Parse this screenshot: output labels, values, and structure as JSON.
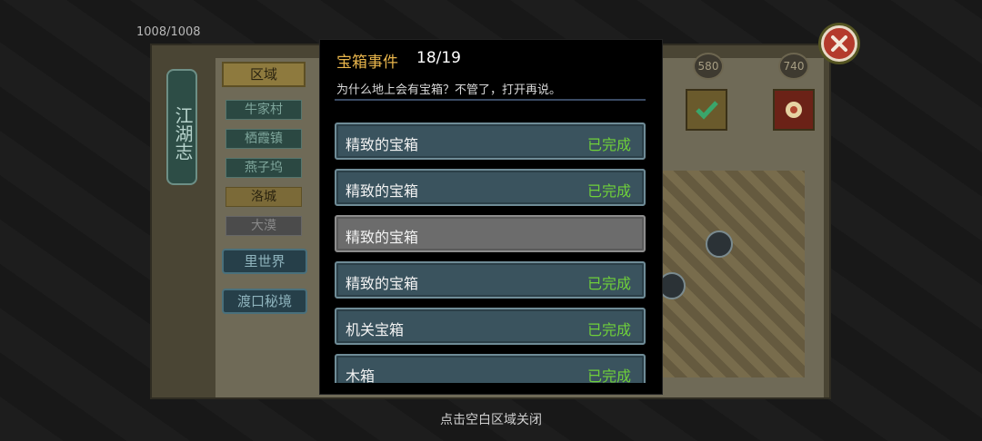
{
  "background": {
    "hp": "1008/1008",
    "banner_title": "江湖志",
    "region_header": "区域",
    "regions": [
      {
        "label": "牛家村",
        "style": "normal"
      },
      {
        "label": "栖霞镇",
        "style": "normal"
      },
      {
        "label": "燕子坞",
        "style": "normal"
      },
      {
        "label": "洛城",
        "style": "gold"
      },
      {
        "label": "大漠",
        "style": "dim"
      }
    ],
    "inner_world": "里世界",
    "ferry_realm": "渡口秘境",
    "top_numbers": [
      "580",
      "740"
    ]
  },
  "modal": {
    "title": "宝箱事件",
    "count": "18/19",
    "description": "为什么地上会有宝箱？不管了，打开再说。",
    "events": [
      {
        "name": "精致的宝箱",
        "status": "已完成",
        "completed": true
      },
      {
        "name": "精致的宝箱",
        "status": "已完成",
        "completed": true
      },
      {
        "name": "精致的宝箱",
        "status": "",
        "completed": false
      },
      {
        "name": "精致的宝箱",
        "status": "已完成",
        "completed": true
      },
      {
        "name": "机关宝箱",
        "status": "已完成",
        "completed": true
      },
      {
        "name": "木箱",
        "status": "已完成",
        "completed": true
      }
    ]
  },
  "close_hint": "点击空白区域关闭",
  "colors": {
    "title_gold": "#e8b54c",
    "completed_green": "#6fd03a",
    "row_teal": "#3a535e",
    "row_pending": "#6c6c6c"
  }
}
